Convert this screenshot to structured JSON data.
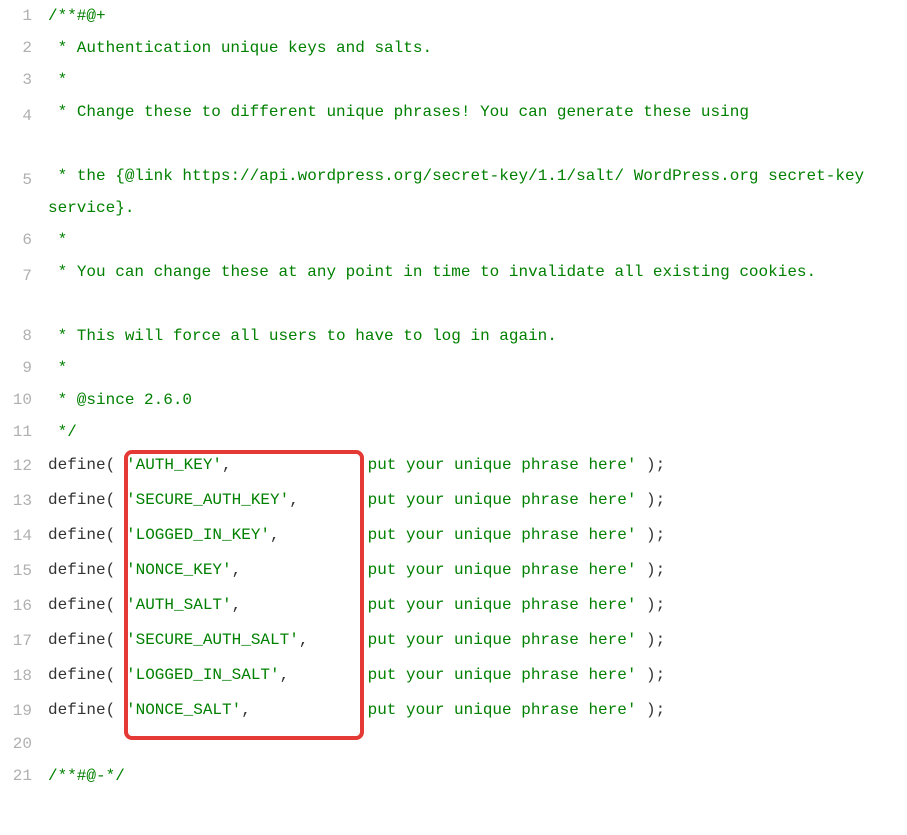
{
  "lineNumbers": [
    "1",
    "2",
    "3",
    "4",
    "5",
    "6",
    "7",
    "8",
    "9",
    "10",
    "11",
    "12",
    "13",
    "14",
    "15",
    "16",
    "17",
    "18",
    "19",
    "20",
    "21"
  ],
  "comments": {
    "l1": "/**#@+",
    "l2": " * Authentication unique keys and salts.",
    "l3": " *",
    "l4": " * Change these to different unique phrases! You can generate these using",
    "l5": " * the {@link https://api.wordpress.org/secret-key/1.1/salt/ WordPress.org secret-key service}.",
    "l6": " *",
    "l7": " * You can change these at any point in time to invalidate all existing cookies.",
    "l8": " * This will force all users to have to log in again.",
    "l9": " *",
    "l10": " * @since 2.6.0",
    "l11": " */",
    "l20": "/**#@-*/"
  },
  "defineFn": "define",
  "openParen": "( ",
  "comma": ",",
  "closeParen": " );",
  "defines": [
    {
      "key": "'AUTH_KEY'",
      "keyPad": "        ",
      "val": "'put your unique phrase here'"
    },
    {
      "key": "'SECURE_AUTH_KEY'",
      "keyPad": " ",
      "val": "'put your unique phrase here'"
    },
    {
      "key": "'LOGGED_IN_KEY'",
      "keyPad": "   ",
      "val": "'put your unique phrase here'"
    },
    {
      "key": "'NONCE_KEY'",
      "keyPad": "       ",
      "val": "'put your unique phrase here'"
    },
    {
      "key": "'AUTH_SALT'",
      "keyPad": "       ",
      "val": "'put your unique phrase here'"
    },
    {
      "key": "'SECURE_AUTH_SALT'",
      "keyPad": "",
      "val": "'put your unique phrase here'"
    },
    {
      "key": "'LOGGED_IN_SALT'",
      "keyPad": "  ",
      "val": "'put your unique phrase here'"
    },
    {
      "key": "'NONCE_SALT'",
      "keyPad": "      ",
      "val": "'put your unique phrase here'"
    }
  ]
}
